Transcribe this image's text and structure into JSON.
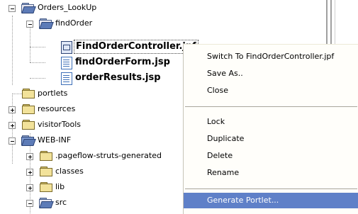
{
  "tree": {
    "items": [
      {
        "label": "Orders_LookUp"
      },
      {
        "label": "findOrder"
      },
      {
        "label": "FindOrderController.jpf"
      },
      {
        "label": "findOrderForm.jsp"
      },
      {
        "label": "orderResults.jsp"
      },
      {
        "label": "portlets"
      },
      {
        "label": "resources"
      },
      {
        "label": "visitorTools"
      },
      {
        "label": "WEB-INF"
      },
      {
        "label": ".pageflow-struts-generated"
      },
      {
        "label": "classes"
      },
      {
        "label": "lib"
      },
      {
        "label": "src"
      }
    ]
  },
  "context_menu": {
    "items": [
      {
        "label": "Switch To FindOrderController.jpf"
      },
      {
        "label": "Save As.."
      },
      {
        "label": "Close"
      },
      {
        "label": "Lock"
      },
      {
        "label": "Duplicate"
      },
      {
        "label": "Delete"
      },
      {
        "label": "Rename"
      },
      {
        "label": "Generate Portlet..."
      }
    ],
    "highlighted": "Generate Portlet...",
    "highlight_color": "#5f80c8"
  }
}
